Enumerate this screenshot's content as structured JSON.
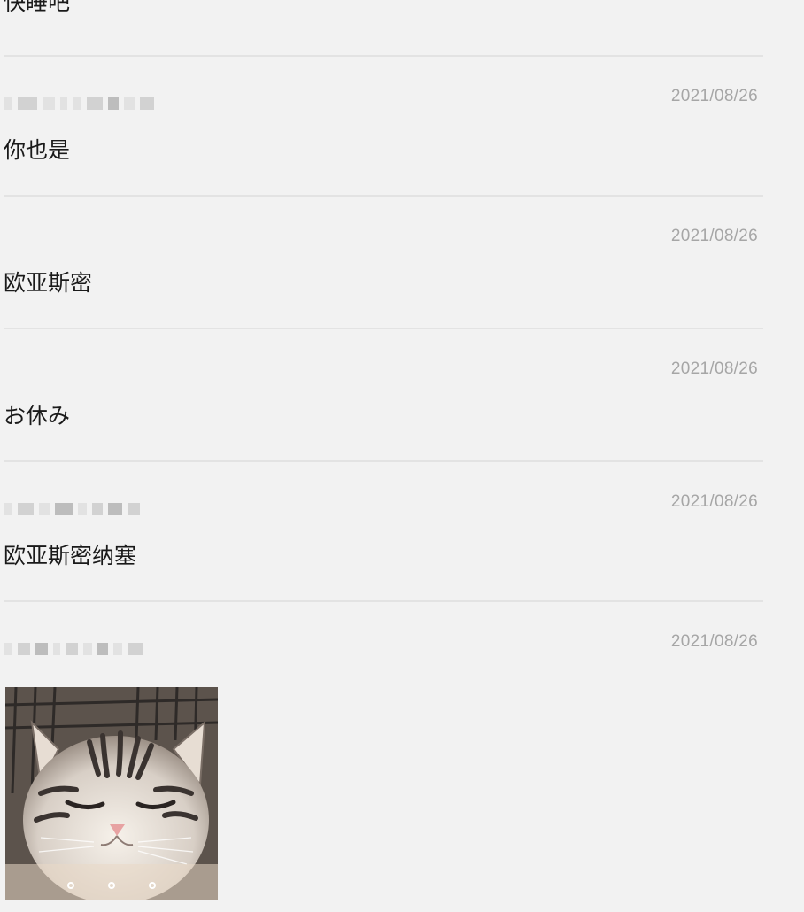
{
  "messages": [
    {
      "text": "快睡吧",
      "date": ""
    },
    {
      "text": "你也是",
      "date": "2021/08/26"
    },
    {
      "text": "欧亚斯密",
      "date": "2021/08/26"
    },
    {
      "text": "お休み",
      "date": "2021/08/26"
    },
    {
      "text": "欧亚斯密纳塞",
      "date": "2021/08/26"
    },
    {
      "text": "",
      "date": "2021/08/26"
    }
  ],
  "media": {
    "icon": "cat-photo",
    "dot_count": 3
  },
  "colors": {
    "background": "#f2f2f2",
    "divider": "#e3e3e3",
    "date_text": "#a6a6a6",
    "message_text": "#1a1a1a"
  }
}
